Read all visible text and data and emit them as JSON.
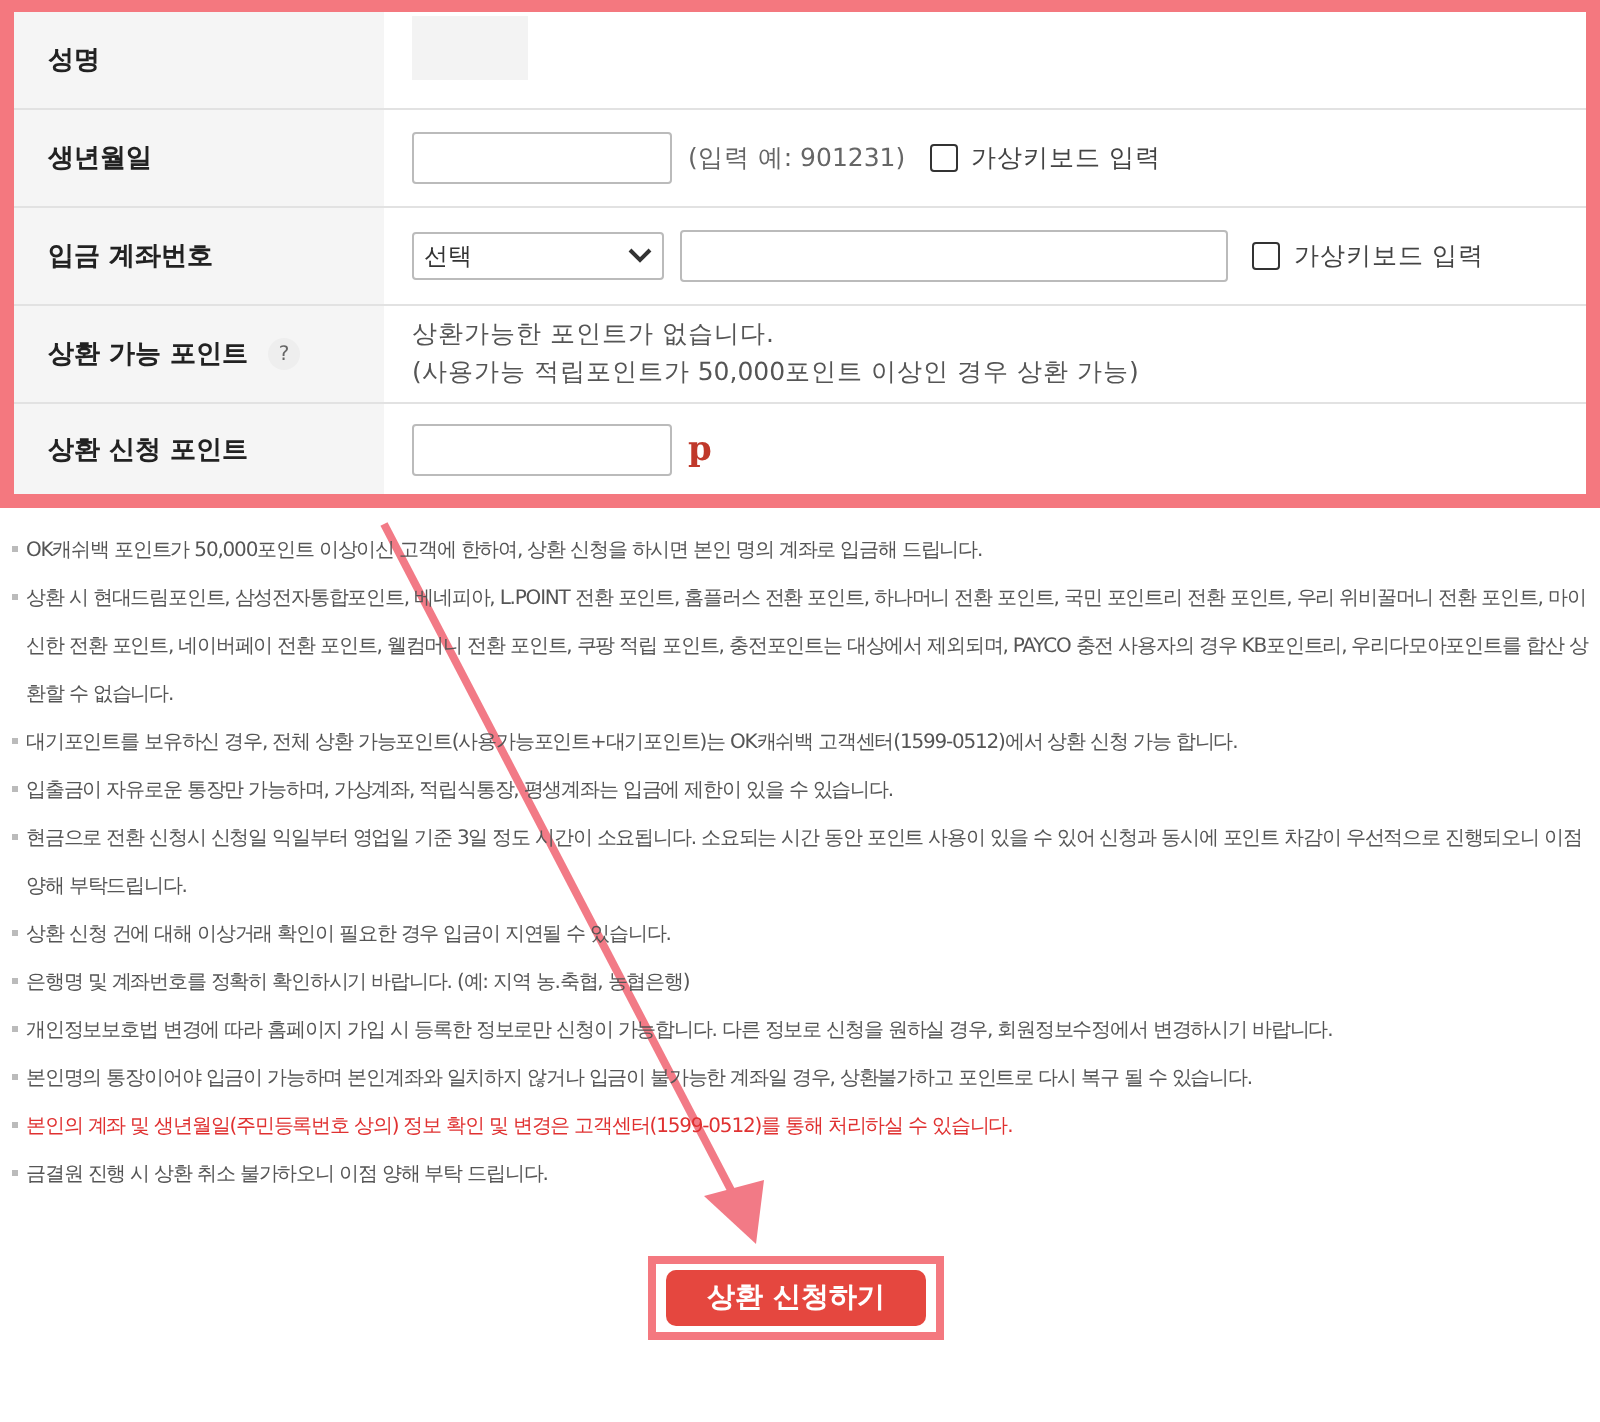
{
  "form": {
    "rows": [
      {
        "kind": "masked",
        "label": "성명"
      },
      {
        "kind": "birth",
        "label": "생년월일",
        "hint": "(입력 예: 901231)",
        "keyboard": {
          "label": "가상키보드 입력",
          "checked": false
        }
      },
      {
        "kind": "account",
        "label": "입금 계좌번호",
        "select": "선택",
        "keyboard": {
          "label": "가상키보드 입력",
          "checked": false
        }
      },
      {
        "kind": "info",
        "label": "상환 가능 포인트",
        "help_mark": "?",
        "lines": [
          "상환가능한 포인트가 없습니다.",
          "(사용가능 적립포인트가 50,000포인트 이상인 경우 상환 가능)"
        ]
      },
      {
        "kind": "points",
        "label": "상환 신청 포인트",
        "unit": "p"
      }
    ]
  },
  "notes": [
    {
      "text": "OK캐쉬백 포인트가 50,000포인트 이상이신 고객에 한하여, 상환 신청을 하시면 본인 명의 계좌로 입금해 드립니다.",
      "emphasis": false
    },
    {
      "text": "상환 시 현대드림포인트, 삼성전자통합포인트, 베네피아, L.POINT 전환 포인트, 홈플러스 전환 포인트, 하나머니 전환 포인트, 국민 포인트리 전환 포인트, 우리 위비꿀머니 전환 포인트, 마이신한 전환 포인트, 네이버페이 전환 포인트, 웰컴머니 전환 포인트, 쿠팡 적립 포인트, 충전포인트는 대상에서 제외되며, PAYCO 충전 사용자의 경우 KB포인트리, 우리다모아포인트를 합산 상환할 수 없습니다.",
      "emphasis": false
    },
    {
      "text": "대기포인트를 보유하신 경우, 전체 상환 가능포인트(사용가능포인트+대기포인트)는 OK캐쉬백 고객센터(1599-0512)에서 상환 신청 가능 합니다.",
      "emphasis": false
    },
    {
      "text": "입출금이 자유로운 통장만 가능하며, 가상계좌, 적립식통장, 평생계좌는 입금에 제한이 있을 수 있습니다.",
      "emphasis": false
    },
    {
      "text": "현금으로 전환 신청시 신청일 익일부터 영업일 기준 3일 정도 시간이 소요됩니다. 소요되는 시간 동안 포인트 사용이 있을 수 있어 신청과 동시에 포인트 차감이 우선적으로 진행되오니 이점 양해 부탁드립니다.",
      "emphasis": false
    },
    {
      "text": "상환 신청 건에 대해 이상거래 확인이 필요한 경우 입금이 지연될 수 있습니다.",
      "emphasis": false
    },
    {
      "text": "은행명 및 계좌번호를 정확히 확인하시기 바랍니다. (예: 지역 농.축협, 농협은행)",
      "emphasis": false
    },
    {
      "text": "개인정보보호법 변경에 따라 홈페이지 가입 시 등록한 정보로만 신청이 가능합니다. 다른 정보로 신청을 원하실 경우, 회원정보수정에서 변경하시기 바랍니다.",
      "emphasis": false
    },
    {
      "text": "본인명의 통장이어야 입금이 가능하며 본인계좌와 일치하지 않거나 입금이 불가능한 계좌일 경우, 상환불가하고 포인트로 다시 복구 될 수 있습니다.",
      "emphasis": false
    },
    {
      "text": "본인의 계좌 및 생년월일(주민등록번호 상의) 정보 확인 및 변경은 고객센터(1599-0512)를 통해 처리하실 수 있습니다.",
      "emphasis": true
    },
    {
      "text": "금결원 진행 시 상환 취소 불가하오니 이점 양해 부탁 드립니다.",
      "emphasis": false
    }
  ],
  "submit": {
    "label": "상환 신청하기"
  }
}
